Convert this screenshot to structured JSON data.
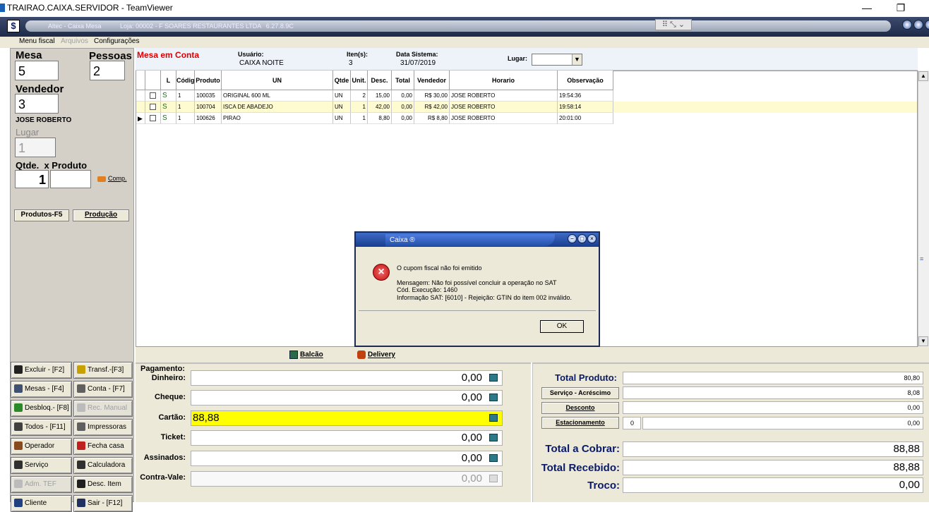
{
  "window": {
    "title": "TRAIRAO.CAIXA.SERVIDOR - TeamViewer",
    "minimize": "—",
    "restore": "❐"
  },
  "app": {
    "caption_name": "Altec - Caixa Mesa",
    "caption_store": "Loja: 00002 - F SOARES RESTAURANTES LTDA",
    "caption_version": "6.27.8.9C",
    "logo": "$"
  },
  "menu": {
    "items": [
      {
        "label": "Menu fiscal",
        "enabled": true
      },
      {
        "label": "Arquivos",
        "enabled": false
      },
      {
        "label": "Configurações",
        "enabled": true
      }
    ]
  },
  "left": {
    "mesa_label": "Mesa",
    "mesa_value": "5",
    "pessoas_label": "Pessoas",
    "pessoas_value": "2",
    "vendedor_label": "Vendedor",
    "vendedor_value": "3",
    "vendedor_name": "JOSE ROBERTO",
    "lugar_label": "Lugar",
    "lugar_value": "1",
    "qtde_label": "Qtde.  x Produto",
    "qtde_value": "1",
    "produto_value": "",
    "comp_label": "Comp.",
    "produtos_btn": "Produtos-F5",
    "producao_btn": "Produção"
  },
  "function_buttons": [
    {
      "label": "Excluir - [F2]",
      "icon": "x-icon",
      "enabled": true
    },
    {
      "label": "Transf.-[F3]",
      "icon": "hand-icon",
      "enabled": true
    },
    {
      "label": "Mesas - [F4]",
      "icon": "search-icon",
      "enabled": true
    },
    {
      "label": "Conta - [F7]",
      "icon": "printer-icon",
      "enabled": true
    },
    {
      "label": "Desbloq.- [F8]",
      "icon": "unlock-icon",
      "enabled": true
    },
    {
      "label": "Rec. Manual",
      "icon": "document-icon",
      "enabled": false
    },
    {
      "label": "Todos - [F11]",
      "icon": "check-icon",
      "enabled": true
    },
    {
      "label": "Impressoras",
      "icon": "printer-icon",
      "enabled": true
    },
    {
      "label": "Operador",
      "icon": "user-icon",
      "enabled": true
    },
    {
      "label": "Fecha casa",
      "icon": "clock-icon",
      "enabled": true
    },
    {
      "label": "Serviço",
      "icon": "service-icon",
      "enabled": true
    },
    {
      "label": "Calculadora",
      "icon": "calculator-icon",
      "enabled": true
    },
    {
      "label": "Adm. TEF",
      "icon": "card-icon",
      "enabled": false
    },
    {
      "label": "Desc. Item",
      "icon": "tag-icon",
      "enabled": true
    },
    {
      "label": "Cliente",
      "icon": "person-icon",
      "enabled": true
    },
    {
      "label": "Sair - [F12]",
      "icon": "exit-icon",
      "enabled": true
    }
  ],
  "header": {
    "status": "Mesa em Conta",
    "usuario_label": "Usuário:",
    "usuario_value": "CAIXA NOITE",
    "itens_label": "Iten(s):",
    "itens_value": "3",
    "data_label": "Data Sistema:",
    "data_value": "31/07/2019",
    "lugar_label": "Lugar:",
    "lugar_value": ""
  },
  "grid": {
    "columns": [
      "",
      "",
      "L",
      "Código",
      "Produto",
      "UN",
      "Qtde",
      "Unit.",
      "Desc.",
      "Total",
      "Vendedor",
      "Horario",
      "Observação"
    ],
    "rows": [
      {
        "flag": "S",
        "l": "1",
        "codigo": "100035",
        "produto": "ORIGINAL 600 ML",
        "un": "UN",
        "qtde": "2",
        "unit": "15,00",
        "desc": "0,00",
        "total": "R$ 30,00",
        "vendedor": "JOSE ROBERTO",
        "horario": "19:54:36",
        "obs": "",
        "current": false,
        "highlight": false
      },
      {
        "flag": "S",
        "l": "1",
        "codigo": "100704",
        "produto": "ISCA DE ABADEJO",
        "un": "UN",
        "qtde": "1",
        "unit": "42,00",
        "desc": "0,00",
        "total": "R$ 42,00",
        "vendedor": "JOSE ROBERTO",
        "horario": "19:58:14",
        "obs": "",
        "current": false,
        "highlight": true
      },
      {
        "flag": "S",
        "l": "1",
        "codigo": "100626",
        "produto": "PIRAO",
        "un": "UN",
        "qtde": "1",
        "unit": "8,80",
        "desc": "0,00",
        "total": "R$ 8,80",
        "vendedor": "JOSE ROBERTO",
        "horario": "20:01:00",
        "obs": "",
        "current": true,
        "highlight": false
      }
    ]
  },
  "dialog": {
    "title": "Caixa",
    "title_suffix": "®",
    "message_title": "O cupom fiscal não foi emitido",
    "line1": "Mensagem: Não foi possível concluir a operação no SAT",
    "line2": "Cód. Execução: 1460",
    "line3": "Informação SAT: [6010] - Rejeição: GTIN do item 002 inválido.",
    "ok_label": "OK"
  },
  "modes": {
    "balcao": "Balcão",
    "delivery": "Delivery"
  },
  "payment": {
    "header": "Pagamento:",
    "fields": [
      {
        "label": "Dinheiro:",
        "value": "0,00",
        "highlight": false,
        "enabled": true
      },
      {
        "label": "Cheque:",
        "value": "0,00",
        "highlight": false,
        "enabled": true
      },
      {
        "label": "Cartão:",
        "value": "88,88",
        "highlight": true,
        "enabled": true
      },
      {
        "label": "Ticket:",
        "value": "0,00",
        "highlight": false,
        "enabled": true
      },
      {
        "label": "Assinados:",
        "value": "0,00",
        "highlight": false,
        "enabled": true
      },
      {
        "label": "Contra-Vale:",
        "value": "0,00",
        "highlight": false,
        "enabled": false
      }
    ]
  },
  "totals": {
    "total_produto_label": "Total Produto:",
    "total_produto": "80,80",
    "servico_btn": "Serviço - Acréscimo",
    "servico": "8,08",
    "desconto_btn": "Desconto",
    "desconto": "0,00",
    "estac_btn": "Estacionamento",
    "estac_qty": "0",
    "estac_value": "0,00",
    "a_cobrar_label": "Total a Cobrar:",
    "a_cobrar": "88,88",
    "recebido_label": "Total Recebido:",
    "recebido": "88,88",
    "troco_label": "Troco:",
    "troco": "0,00"
  },
  "colors": {
    "highlight_row": "#fffbd0",
    "yellow_field": "#ffff00",
    "status_red": "#e00000",
    "totals_blue": "#0a1a6a"
  }
}
